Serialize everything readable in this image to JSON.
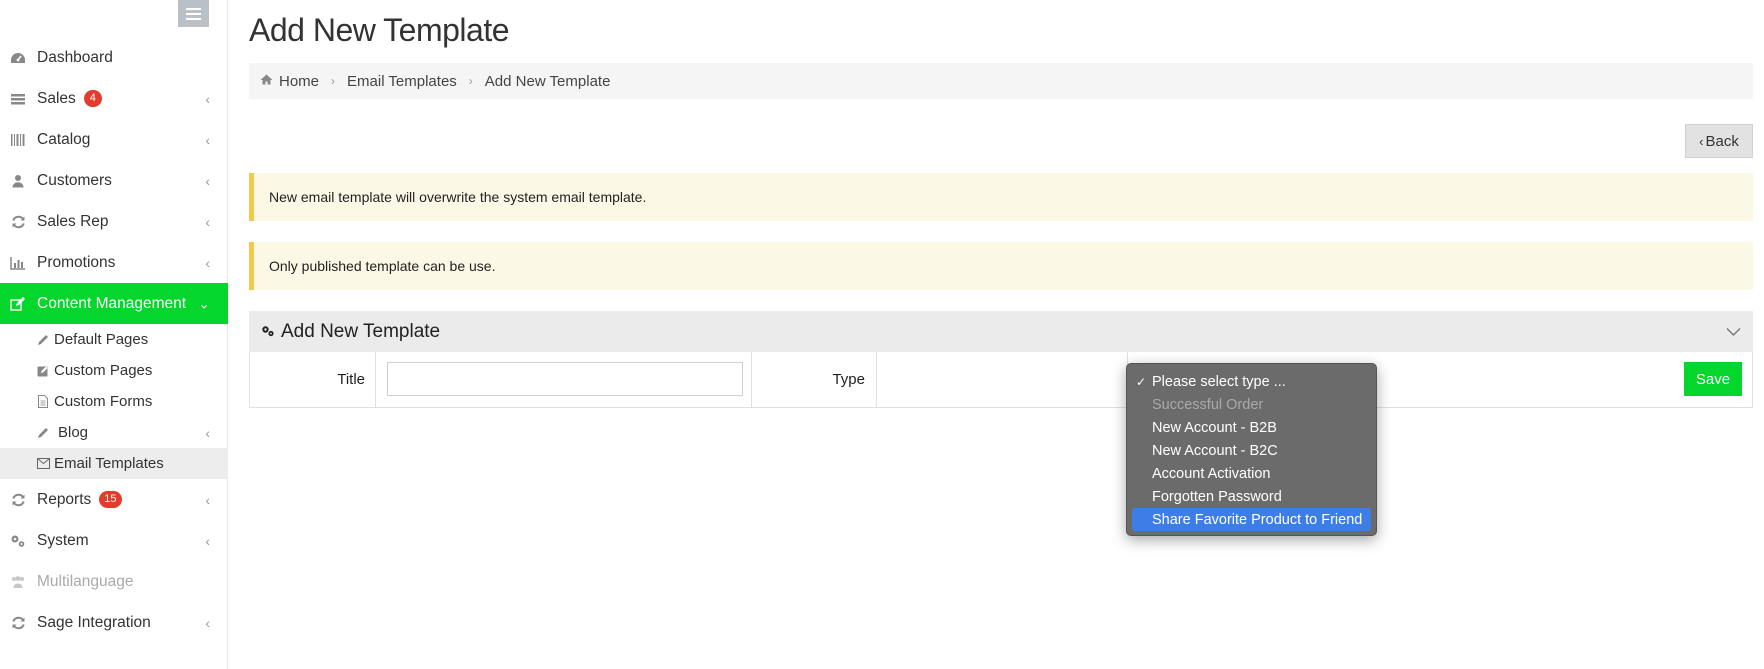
{
  "sidebar": {
    "items": [
      {
        "label": "Dashboard",
        "icon": "dashboard-icon"
      },
      {
        "label": "Sales",
        "badge": "4",
        "icon": "sales-icon"
      },
      {
        "label": "Catalog",
        "icon": "catalog-icon"
      },
      {
        "label": "Customers",
        "icon": "user-icon"
      },
      {
        "label": "Sales Rep",
        "icon": "refresh-icon"
      },
      {
        "label": "Promotions",
        "icon": "bar-chart-icon"
      },
      {
        "label": "Content Management",
        "icon": "edit-icon"
      },
      {
        "label": "Reports",
        "badge": "15",
        "icon": "refresh-icon"
      },
      {
        "label": "System",
        "icon": "gears-icon"
      },
      {
        "label": "Multilanguage",
        "icon": "users-icon"
      },
      {
        "label": "Sage Integration",
        "icon": "refresh-icon"
      }
    ],
    "submenu": [
      {
        "label": "Default Pages",
        "icon": "pencil-icon"
      },
      {
        "label": "Custom Pages",
        "icon": "edit-square-icon"
      },
      {
        "label": "Custom Forms",
        "icon": "file-icon"
      },
      {
        "label": "Blog",
        "icon": "pencil-icon"
      },
      {
        "label": "Email Templates",
        "icon": "envelope-icon"
      }
    ]
  },
  "page": {
    "title": "Add New Template",
    "back_label": "Back"
  },
  "breadcrumb": [
    "Home",
    "Email Templates",
    "Add New Template"
  ],
  "alerts": [
    "New email template will overwrite the system email template.",
    "Only published template can be use."
  ],
  "form": {
    "panel_title": "Add New Template",
    "title_label": "Title",
    "title_value": "",
    "type_label": "Type",
    "save_label": "Save"
  },
  "type_dropdown": {
    "options": [
      "Please select type ...",
      "Successful Order",
      "New Account - B2B",
      "New Account - B2C",
      "Account Activation",
      "Forgotten Password",
      "Share Favorite Product to Friend"
    ],
    "selected": "Please select type ...",
    "highlighted": "Share Favorite Product to Friend",
    "disabled": [
      "Successful Order"
    ]
  },
  "colors": {
    "accent_green": "#04d62b",
    "badge_red": "#e23c2c",
    "highlight_blue": "#3d7de8"
  }
}
